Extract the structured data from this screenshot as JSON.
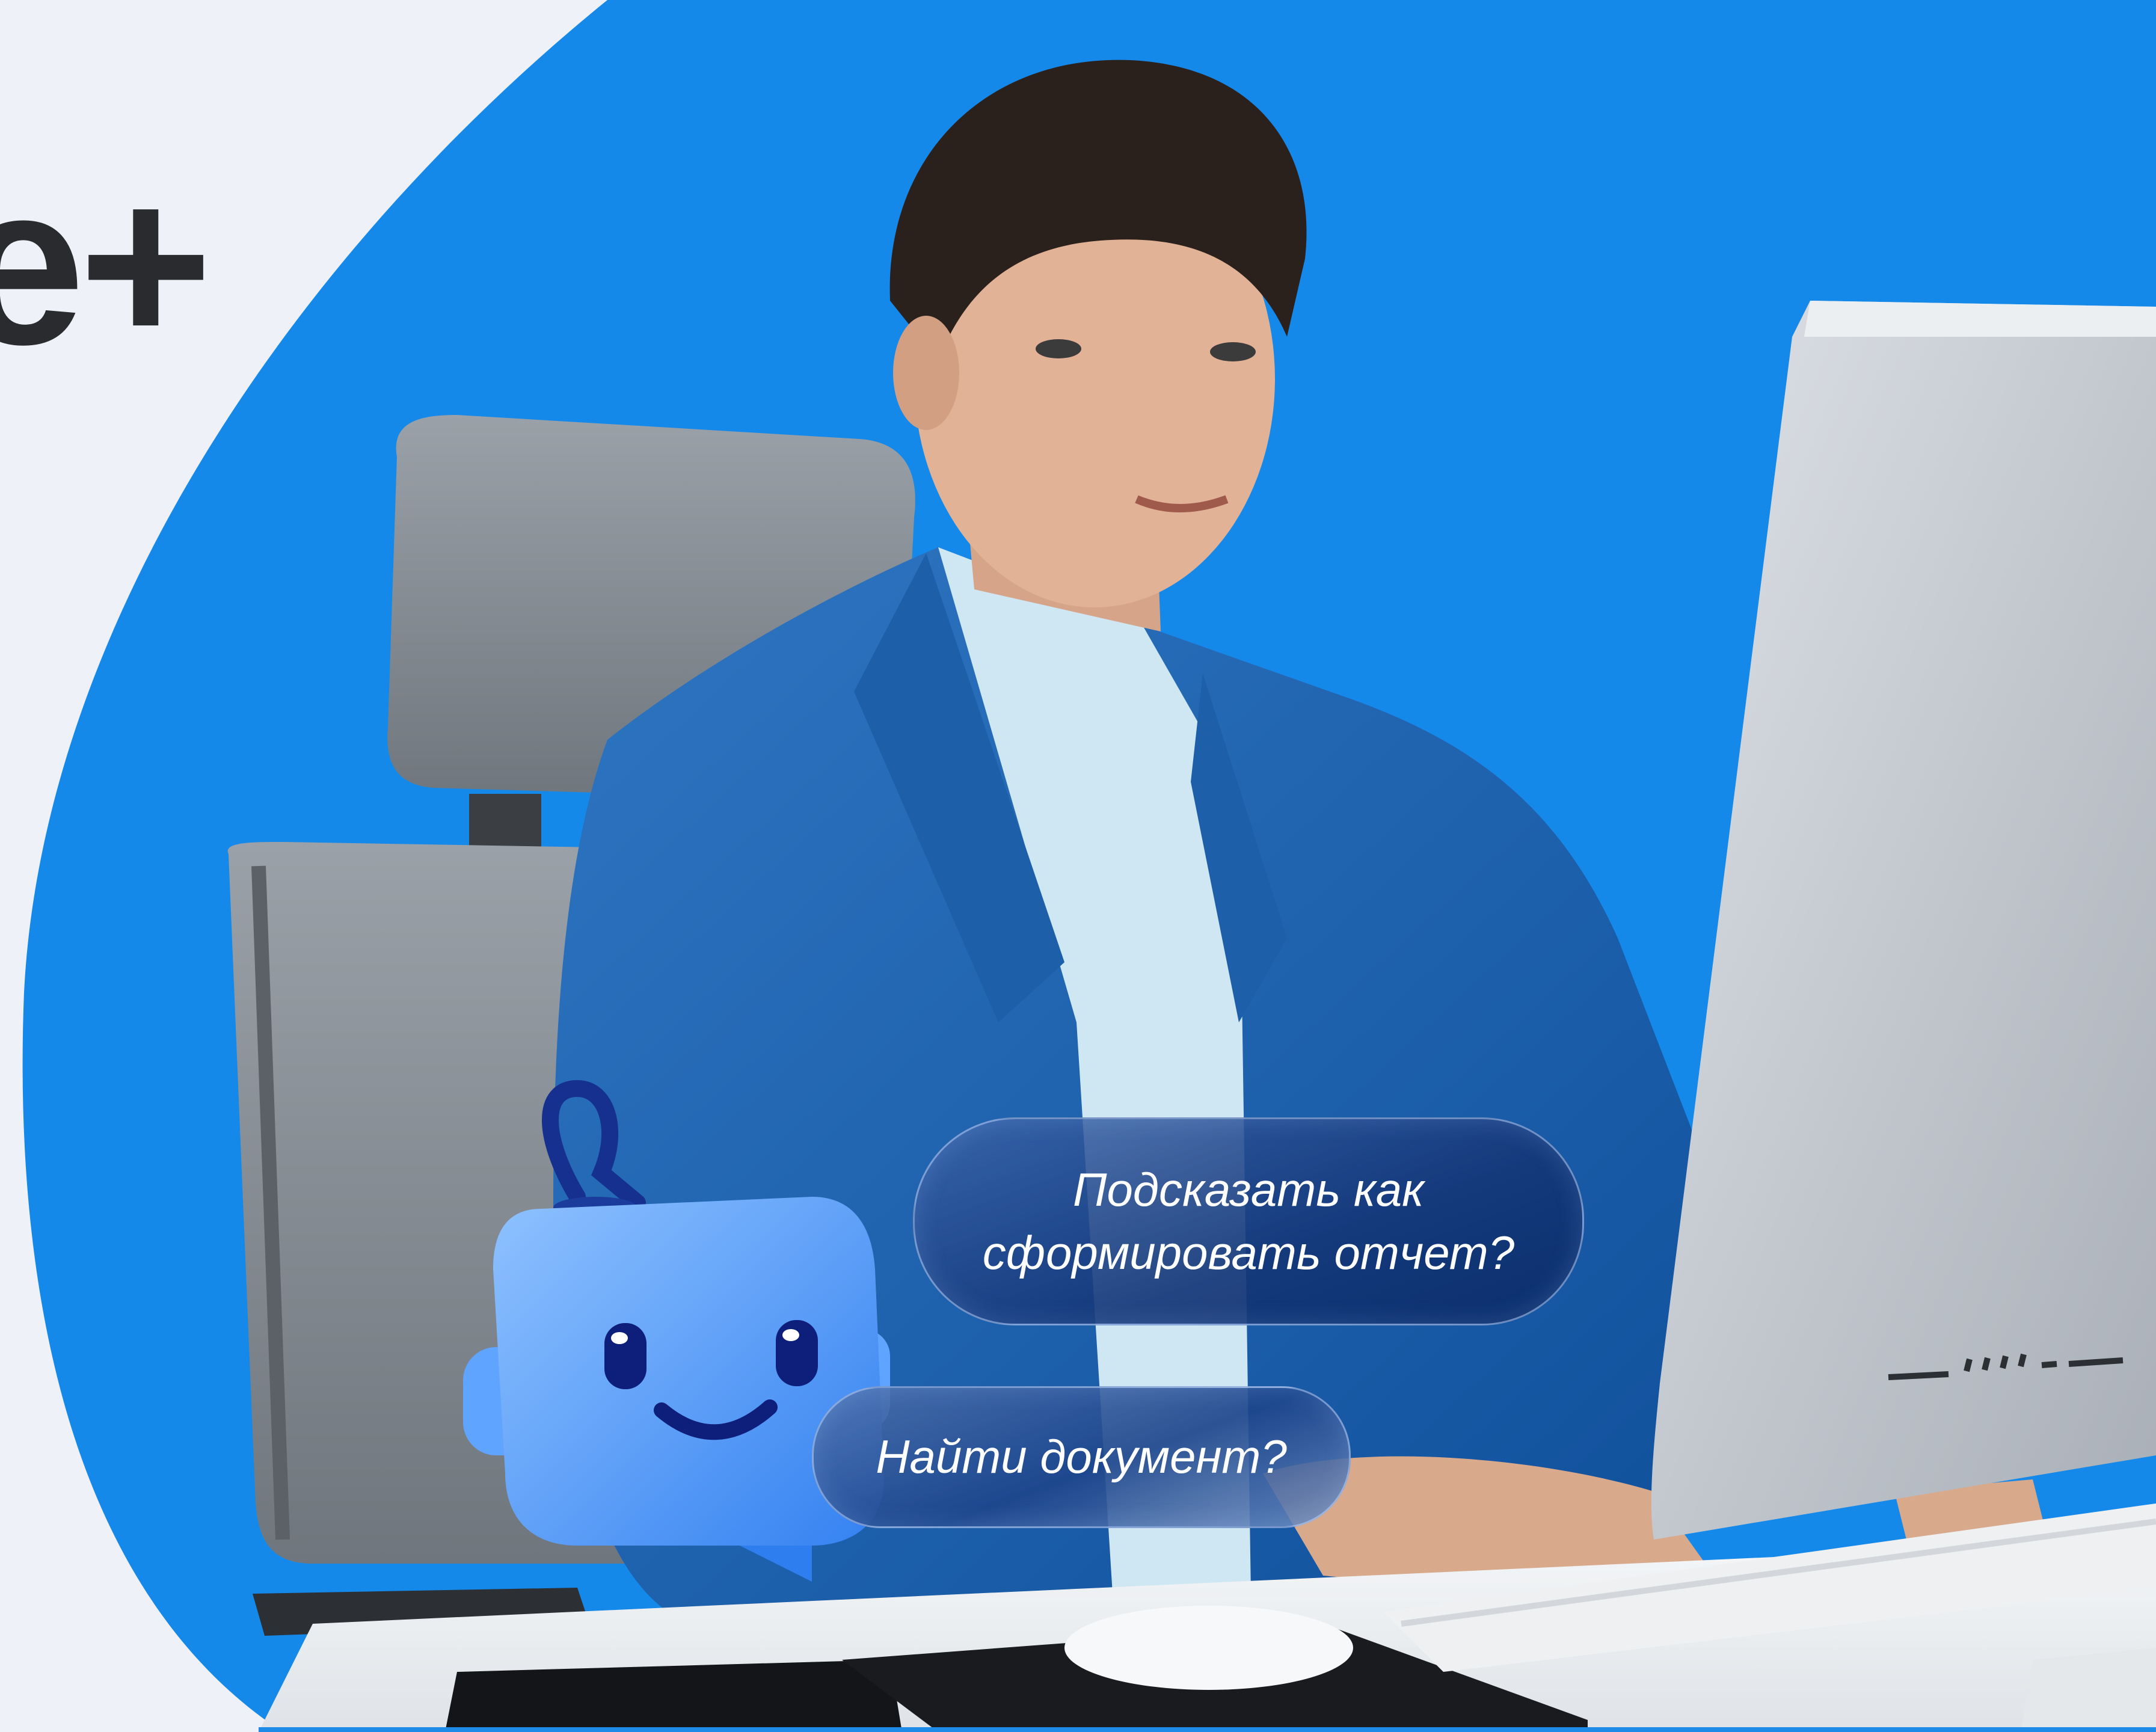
{
  "brand": {
    "logo_fragment": "e+"
  },
  "chat": {
    "suggestion_1": "Подсказать как сформировать отчет?",
    "suggestion_2": "Найти документ?"
  },
  "colors": {
    "background": "#eef1f7",
    "accent_blue": "#1589e9",
    "logo_text": "#2a2b2f",
    "bubble_text": "#ffffff"
  },
  "icons": {
    "assistant": "robot-chat-mascot-icon"
  }
}
